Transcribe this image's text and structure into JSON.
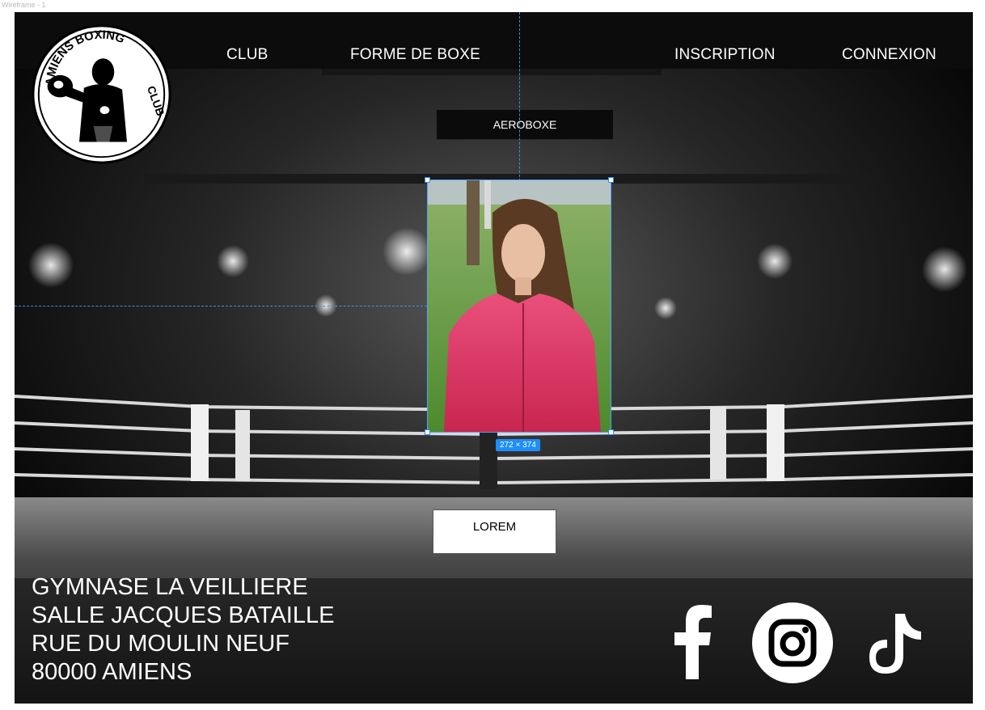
{
  "frame": {
    "label": "Wireframe - 1"
  },
  "logo": {
    "text_top": "AMIENS BOXING",
    "text_side": "CLUB"
  },
  "nav": {
    "club": "CLUB",
    "forme": "FORME DE BOXE",
    "inscription": "INSCRIPTION",
    "connexion": "CONNEXION"
  },
  "submenu": {
    "aeroboxe": "AEROBOXE"
  },
  "selection": {
    "dimensions": "272 × 374"
  },
  "cta": {
    "label": "LOREM"
  },
  "address": {
    "line1": "GYMNASE LA VEILLIERE",
    "line2": "SALLE JACQUES BATAILLE",
    "line3": "RUE DU MOULIN NEUF",
    "line4": "80000 AMIENS"
  },
  "social": [
    "facebook-icon",
    "instagram-icon",
    "tiktok-icon"
  ],
  "colors": {
    "accent": "#1e8efb",
    "text": "#ffffff",
    "background": "#050505"
  }
}
